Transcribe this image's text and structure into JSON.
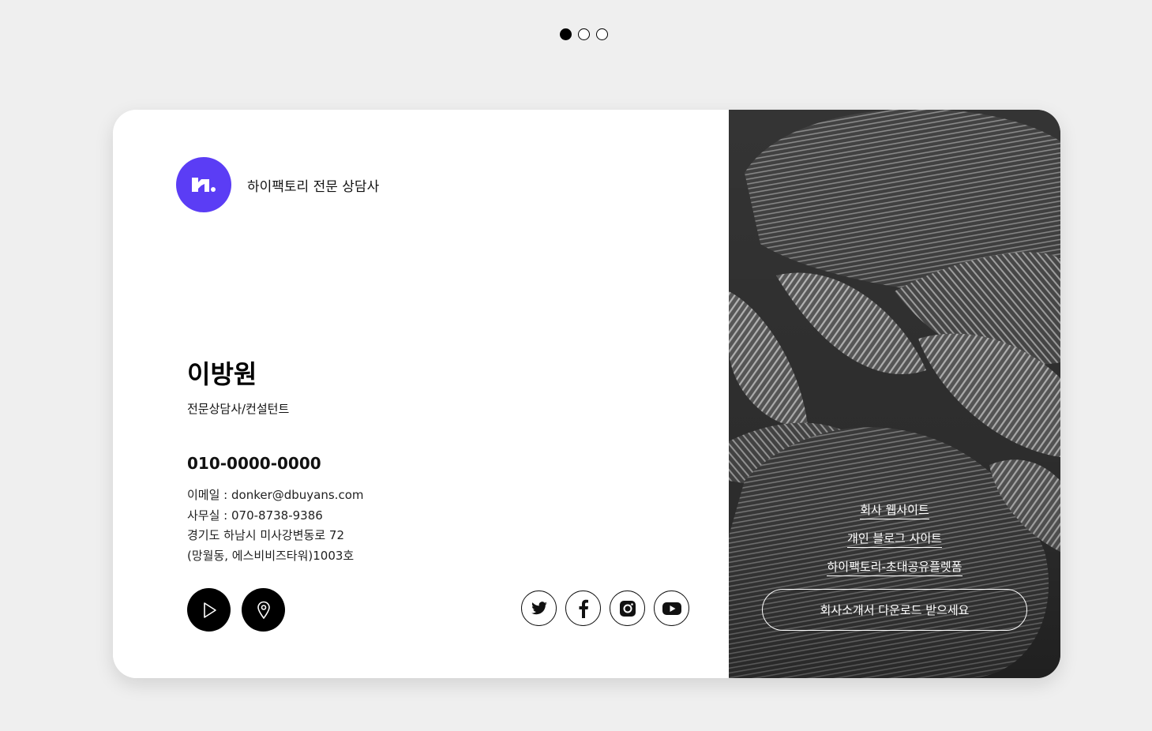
{
  "slider": {
    "dots": 3,
    "active": 0
  },
  "brand": {
    "name": "하이팩토리 전문 상담사",
    "logo_icon": "hifactory-logo-icon",
    "color": "#5b3df5"
  },
  "profile": {
    "name": "이방원",
    "title": "전문상담사/컨설턴트",
    "phone": "010-0000-0000",
    "email_line": "이메일 : donker@dbuyans.com",
    "office_line": "사무실 : 070-8738-9386",
    "address_line1": "경기도 하남시 미사강변동로 72",
    "address_line2": "(망월동, 에스비비즈타워)1003호"
  },
  "actions": {
    "play_icon": "play-icon",
    "location_icon": "location-pin-icon"
  },
  "socials": [
    "twitter-icon",
    "facebook-icon",
    "instagram-icon",
    "youtube-icon"
  ],
  "links": {
    "company_site": "회사 웹사이트",
    "personal_blog": "개인 블로그 사이트",
    "platform": "하이팩토리-초대공유플렛폼",
    "download": "회사소개서 다운로드 받으세요"
  }
}
